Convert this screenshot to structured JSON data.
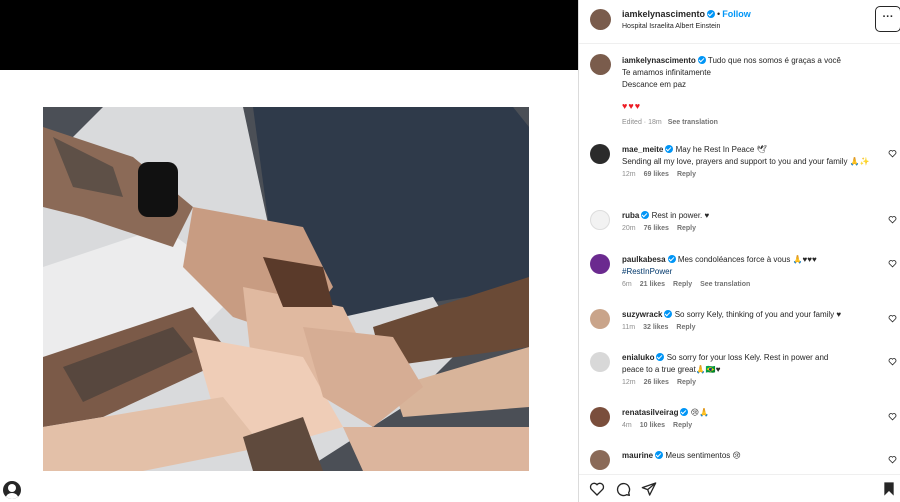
{
  "post": {
    "username": "iamkelynascimento",
    "follow_label": "Follow",
    "separator": "•",
    "location": "Hospital Israelita Albert Einstein",
    "more_label": "···"
  },
  "caption": {
    "username": "iamkelynascimento",
    "lines": [
      "Tudo que nos somos é graças a você",
      "Te amamos infinitamente",
      "Descance em paz"
    ],
    "emoji": "♥♥♥",
    "edited": "Edited · 18m",
    "see_translation": "See translation"
  },
  "comments": [
    {
      "user": "mae_meite",
      "text": "May he Rest In Peace 🕊",
      "extra": "Sending all my love, prayers and support to you and your family 🙏✨",
      "time": "12m",
      "likes": "69 likes",
      "reply": "Reply",
      "translation": ""
    },
    {
      "user": "ruba",
      "text": "Rest in power. ♥",
      "extra": "",
      "time": "20m",
      "likes": "76 likes",
      "reply": "Reply",
      "translation": ""
    },
    {
      "user": "paulkabesa",
      "text": "Mes condoléances force à vous 🙏♥♥♥",
      "extra": "#RestInPower",
      "time": "6m",
      "likes": "21 likes",
      "reply": "Reply",
      "translation": "See translation"
    },
    {
      "user": "suzywrack",
      "text": "So sorry Kely, thinking of you and your family ♥",
      "extra": "",
      "time": "11m",
      "likes": "32 likes",
      "reply": "Reply",
      "translation": ""
    },
    {
      "user": "enialuko",
      "text": "So sorry for your loss Kely. Rest in power and",
      "extra": "peace to a true great🙏🇧🇷♥",
      "time": "12m",
      "likes": "26 likes",
      "reply": "Reply",
      "translation": ""
    },
    {
      "user": "renatasilveirag",
      "text": "😢🙏",
      "extra": "",
      "time": "4m",
      "likes": "10 likes",
      "reply": "Reply",
      "translation": ""
    },
    {
      "user": "maurine",
      "text": "Meus sentimentos 😢",
      "extra": "",
      "time": "",
      "likes": "",
      "reply": "",
      "translation": ""
    }
  ],
  "colors": {
    "accent": "#0095f6",
    "heart": "#ed1c24",
    "muted": "#8e8e8e"
  },
  "icons": [
    "verified-badge-icon",
    "more-options-icon",
    "like-heart-icon",
    "comment-icon",
    "share-icon",
    "save-bookmark-icon"
  ]
}
